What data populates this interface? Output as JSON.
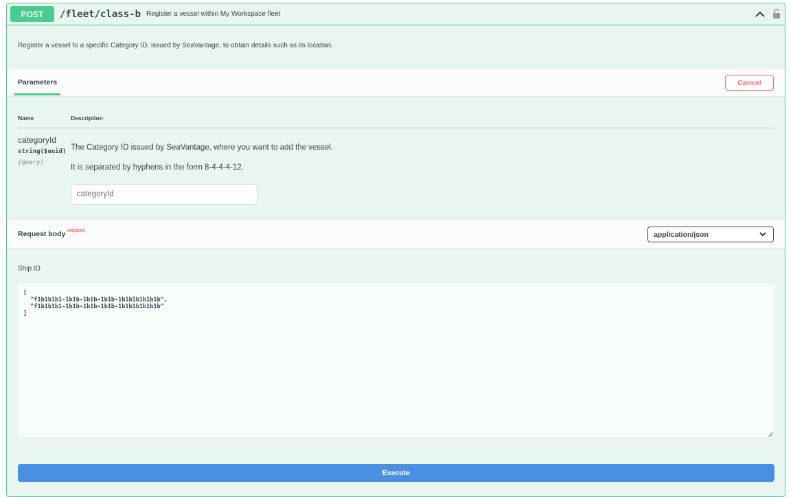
{
  "operation": {
    "method": "POST",
    "path": "/fleet/class-b",
    "summary": "Register a vessel within My Workspace fleet",
    "description": "Register a vessel to a specific Category ID, issued by SeaVantage, to obtain details such as its location."
  },
  "parameters_section": {
    "tab_label": "Parameters",
    "cancel_label": "Cancel",
    "columns": {
      "name": "Name",
      "description": "Description"
    },
    "params": [
      {
        "name": "categoryId",
        "type": "string($uuid)",
        "in": "(query)",
        "description_lines": [
          "The Category ID issued by SeaVantage, where you want to add the vessel.",
          "It is separated by hyphens in the form 8-4-4-4-12."
        ],
        "placeholder": "categoryId",
        "value": ""
      }
    ]
  },
  "request_body": {
    "title": "Request body",
    "required_label": "required",
    "content_type": "application/json",
    "field_label": "Ship ID",
    "body_text": "[\n  \"f1b1b1b1-1b1b-1b1b-1b1b-1b1b1b1b1b1b\",\n  \"f1b1b1b1-1b1b-1b1b-1b1b-1b1b1b1b1b1b\"\n]"
  },
  "execute_label": "Execute",
  "icons": {
    "collapse": "chevron-up-icon",
    "auth": "lock-icon",
    "select": "chevron-down-icon"
  },
  "colors": {
    "post_green": "#49cc90",
    "block_bg": "#e8f6ef",
    "cancel_red": "#ff6060",
    "execute_blue": "#4990e2"
  }
}
